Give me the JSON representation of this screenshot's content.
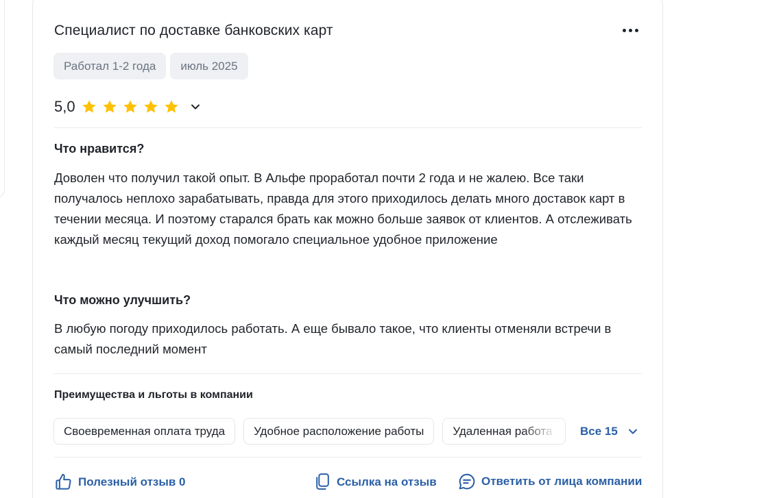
{
  "review": {
    "title": "Специалист по доставке банковских карт",
    "tags": [
      "Работал 1-2 года",
      "июль 2025"
    ],
    "rating": "5,0",
    "stars_filled": 5,
    "stars_total": 5,
    "likes": {
      "heading": "Что нравится?",
      "text": "Доволен что получил такой опыт. В Альфе проработал почти 2 года и не жалею. Все таки получалось неплохо зарабатывать, правда для этого приходилось делать много доставок карт в течении месяца. И поэтому старался брать как можно больше заявок от клиентов. А отслеживать каждый месяц текущий доход помогало специальное удобное приложение"
    },
    "improve": {
      "heading": "Что можно улучшить?",
      "text": "В любую погоду приходилось работать. А еще бывало такое, что клиенты отменяли встречи в самый последний момент"
    },
    "benefits": {
      "heading": "Преимущества и льготы в компании",
      "chips": [
        "Своевременная оплата труда",
        "Удобное расположение работы",
        "Удаленная работа"
      ],
      "all_label": "Все 15"
    },
    "actions": {
      "helpful": "Полезный отзыв 0",
      "link": "Ссылка на отзыв",
      "reply": "Ответить от лица компании"
    }
  },
  "colors": {
    "star": "#ffc107",
    "link": "#2a5fa6",
    "tag_bg": "#eef0f3",
    "text": "#1f2329"
  },
  "icons": [
    "more-icon",
    "star-icon",
    "chevron-down-icon",
    "thumbs-up-icon",
    "copy-link-icon",
    "comment-icon"
  ]
}
